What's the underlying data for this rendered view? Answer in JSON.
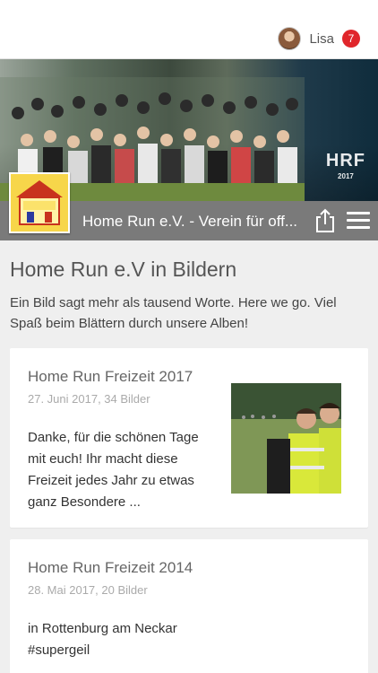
{
  "header": {
    "user_name": "Lisa",
    "notification_count": "7"
  },
  "hero": {
    "watermark_title": "HRF",
    "watermark_year": "2017"
  },
  "titlebar": {
    "logo_icon": "home-run-logo-icon",
    "title": "Home Run e.V. - Verein für off...",
    "share_icon": "share-icon",
    "menu_icon": "hamburger-menu-icon"
  },
  "page": {
    "title": "Home Run e.V in Bildern",
    "intro": "Ein Bild sagt mehr als tausend Worte. Here we go. Viel Spaß beim Blättern durch unsere Alben!"
  },
  "albums": [
    {
      "title": "Home Run Freizeit 2017",
      "meta": "27. Juni 2017, 34 Bilder",
      "text": "Danke, für die schönen Tage mit euch! Ihr macht diese Freizeit jedes Jahr zu etwas ganz Besondere ..."
    },
    {
      "title": "Home Run Freizeit 2014",
      "meta": "28. Mai 2017, 20 Bilder",
      "text": "in Rottenburg am Neckar #supergeil"
    }
  ],
  "colors": {
    "titlebar_bg": "#7a7a7a",
    "badge_bg": "#e0262b",
    "page_bg": "#efefef"
  }
}
